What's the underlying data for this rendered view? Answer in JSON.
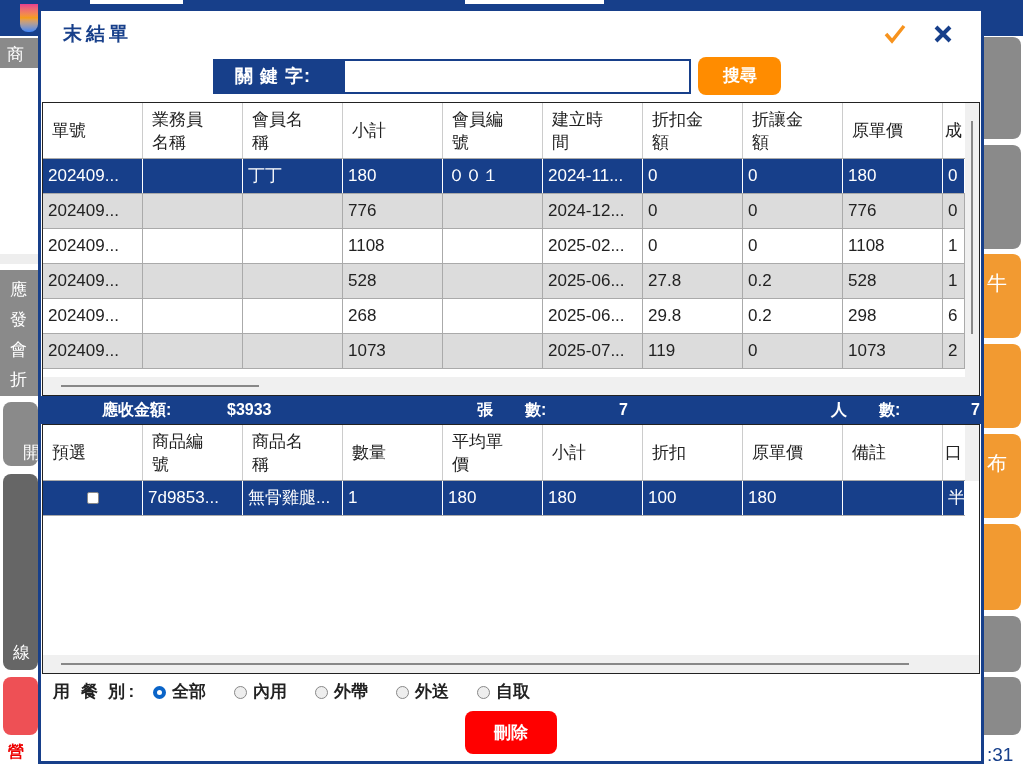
{
  "background": {
    "left_labels": [
      "商",
      "應",
      "發",
      "會",
      "折",
      "開",
      "線",
      "營"
    ],
    "right_labels": [
      "牛",
      "布"
    ],
    "clock": ":31"
  },
  "dialog": {
    "title": "末結單",
    "keyword": {
      "label": "關 鍵 字:"
    },
    "search_button": "搜尋"
  },
  "orders": {
    "columns": [
      "單號",
      "業務員名稱",
      "會員名稱",
      "小計",
      "會員編號",
      "建立時間",
      "折扣金額",
      "折讓金額",
      "原單價",
      "成"
    ],
    "rows": [
      {
        "selected": true,
        "cells": [
          "202409...",
          "",
          "丁丁",
          "180",
          "００１",
          "2024-11...",
          "0",
          "0",
          "180",
          "0"
        ]
      },
      {
        "selected": false,
        "cells": [
          "202409...",
          "",
          "",
          "776",
          "",
          "2024-12...",
          "0",
          "0",
          "776",
          "0"
        ]
      },
      {
        "selected": false,
        "cells": [
          "202409...",
          "",
          "",
          "1108",
          "",
          "2025-02...",
          "0",
          "0",
          "1108",
          "1"
        ]
      },
      {
        "selected": false,
        "cells": [
          "202409...",
          "",
          "",
          "528",
          "",
          "2025-06...",
          "27.8",
          "0.2",
          "528",
          "1"
        ]
      },
      {
        "selected": false,
        "cells": [
          "202409...",
          "",
          "",
          "268",
          "",
          "2025-06...",
          "29.8",
          "0.2",
          "298",
          "6"
        ]
      },
      {
        "selected": false,
        "cells": [
          "202409...",
          "",
          "",
          "1073",
          "",
          "2025-07...",
          "119",
          "0",
          "1073",
          "2"
        ]
      }
    ]
  },
  "summary": [
    {
      "label": "應收金額:",
      "value": "$3933"
    },
    {
      "label": "張　　數:",
      "value": "7"
    },
    {
      "label": "人　　數:",
      "value": "7"
    }
  ],
  "items": {
    "columns": [
      "預選",
      "商品編號",
      "商品名稱",
      "數量",
      "平均單價",
      "小計",
      "折扣",
      "原單價",
      "備註",
      "口"
    ],
    "rows": [
      {
        "selected": true,
        "checked": false,
        "cells": [
          "",
          "7d9853...",
          "無骨雞腿...",
          "1",
          "180",
          "180",
          "100",
          "180",
          "",
          "半"
        ]
      }
    ]
  },
  "meal_type": {
    "label": "用 餐 別:",
    "options": [
      {
        "label": "全部",
        "selected": true
      },
      {
        "label": "內用",
        "selected": false
      },
      {
        "label": "外帶",
        "selected": false
      },
      {
        "label": "外送",
        "selected": false
      },
      {
        "label": "自取",
        "selected": false
      }
    ]
  },
  "delete_button": "刪除"
}
